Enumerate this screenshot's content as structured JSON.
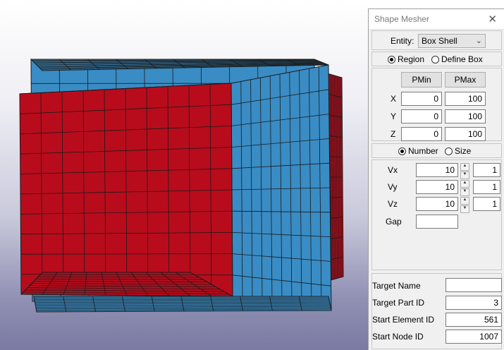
{
  "panel": {
    "title": "Shape Mesher",
    "close_glyph": "✕",
    "entity_label": "Entity:",
    "entity_value": "Box Shell",
    "region_mode": {
      "region": "Region",
      "define_box": "Define Box",
      "selected": "Region"
    },
    "columns": {
      "pmin": "PMin",
      "pmax": "PMax"
    },
    "axes": [
      {
        "label": "X",
        "pmin": "0",
        "pmax": "100"
      },
      {
        "label": "Y",
        "pmin": "0",
        "pmax": "100"
      },
      {
        "label": "Z",
        "pmin": "0",
        "pmax": "100"
      }
    ],
    "division_mode": {
      "number": "Number",
      "size": "Size",
      "selected": "Number"
    },
    "divisions": [
      {
        "label": "Vx",
        "value": "10",
        "bias": "1"
      },
      {
        "label": "Vy",
        "value": "10",
        "bias": "1"
      },
      {
        "label": "Vz",
        "value": "10",
        "bias": "1"
      }
    ],
    "gap_label": "Gap",
    "gap_value": "",
    "target": {
      "name_label": "Target Name",
      "name_value": "",
      "part_label": "Target Part ID",
      "part_value": "3",
      "element_label": "Start Element ID",
      "element_value": "561",
      "node_label": "Start Node ID",
      "node_value": "1007"
    }
  },
  "viewport": {
    "colors": {
      "blue_shell": "#3a8cc4",
      "red_shell": "#b80c1c",
      "mesh_line": "#1a1a1a"
    },
    "mesh_divisions": 10
  }
}
